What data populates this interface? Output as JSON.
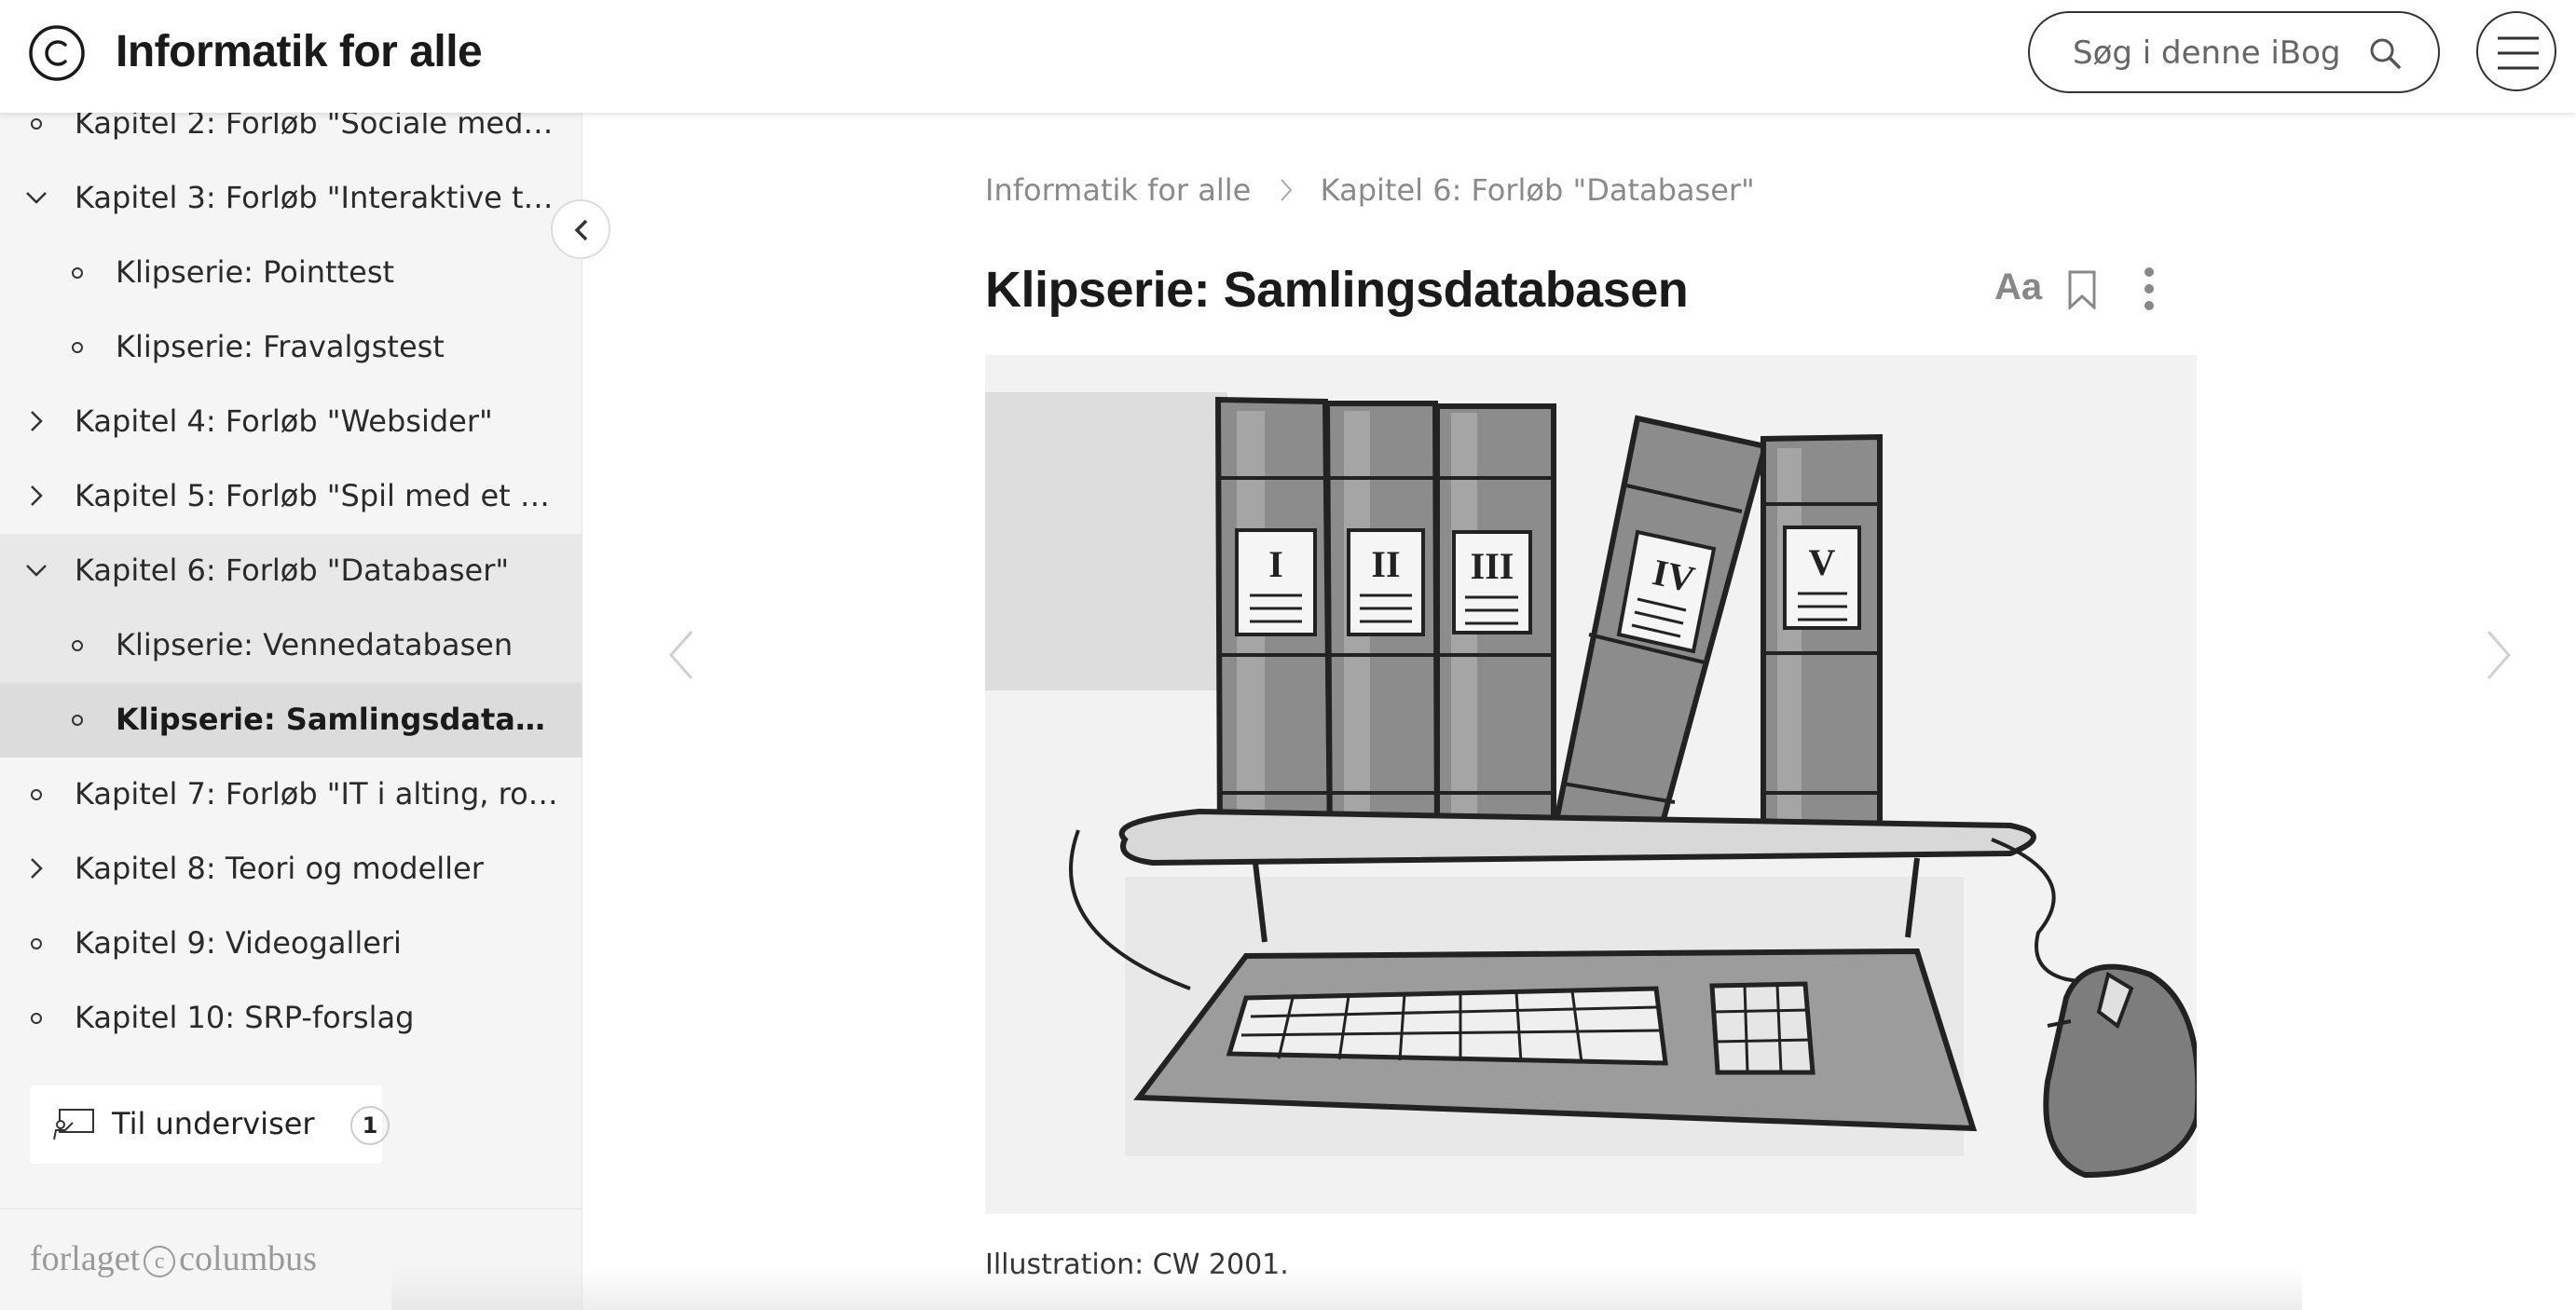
{
  "header": {
    "title": "Informatik for alle",
    "logo_icon": "copyright-circle-logo",
    "search_placeholder": "Søg i denne iBog",
    "menu_icon": "hamburger-icon"
  },
  "sidebar": {
    "items": [
      {
        "label": "Kapitel 2: Forløb \"Sociale medier, di...",
        "level": 1,
        "icon": "bullet"
      },
      {
        "label": "Kapitel 3: Forløb \"Interaktive test\"",
        "level": 1,
        "icon": "chevron-down"
      },
      {
        "label": "Klipserie: Pointtest",
        "level": 2,
        "icon": "bullet"
      },
      {
        "label": "Klipserie: Fravalgstest",
        "level": 2,
        "icon": "bullet"
      },
      {
        "label": "Kapitel 4: Forløb \"Websider\"",
        "level": 1,
        "icon": "chevron-right"
      },
      {
        "label": "Kapitel 5: Forløb \"Spil med et buds...",
        "level": 1,
        "icon": "chevron-right"
      },
      {
        "label": "Kapitel 6: Forløb \"Databaser\"",
        "level": 1,
        "icon": "chevron-down"
      },
      {
        "label": "Klipserie: Vennedatabasen",
        "level": 2,
        "icon": "bullet"
      },
      {
        "label": "Klipserie: Samlingsdatabasen",
        "level": 2,
        "icon": "bullet"
      },
      {
        "label": "Kapitel 7: Forløb \"IT i alting, robott...",
        "level": 1,
        "icon": "bullet"
      },
      {
        "label": "Kapitel 8: Teori og modeller",
        "level": 1,
        "icon": "chevron-right"
      },
      {
        "label": "Kapitel 9: Videogalleri",
        "level": 1,
        "icon": "bullet"
      },
      {
        "label": "Kapitel 10: SRP-forslag",
        "level": 1,
        "icon": "bullet"
      }
    ],
    "teacher_button": {
      "label": "Til underviser",
      "badge": "1"
    },
    "publisher": {
      "left": "forlaget",
      "right": "columbus"
    }
  },
  "main": {
    "breadcrumb": [
      "Informatik for alle",
      "Kapitel 6: Forløb \"Databaser\""
    ],
    "title": "Klipserie: Samlingsdatabasen",
    "tools": {
      "font_size_label": "Aa"
    },
    "figure": {
      "spine_labels": [
        "I",
        "II",
        "III",
        "IV",
        "V"
      ],
      "caption": "Illustration: CW 2001."
    }
  }
}
